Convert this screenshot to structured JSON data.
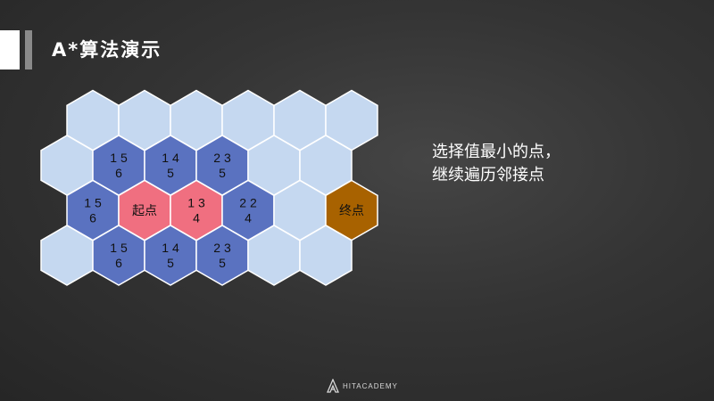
{
  "title": "A*算法演示",
  "instruction": {
    "line1": "选择值最小的点，",
    "line2": "继续遍历邻接点"
  },
  "colors": {
    "empty": "#c5d8f0",
    "neighbor": "#5a72c0",
    "open": "#f06f80",
    "start": "#f06f80",
    "goal": "#a86200",
    "outline": "#ffffff"
  },
  "grid": {
    "rows": [
      [
        {
          "state": "empty",
          "lines": []
        },
        {
          "state": "empty",
          "lines": []
        },
        {
          "state": "empty",
          "lines": []
        },
        {
          "state": "empty",
          "lines": []
        },
        {
          "state": "empty",
          "lines": []
        },
        {
          "state": "empty",
          "lines": []
        }
      ],
      [
        {
          "state": "empty",
          "lines": []
        },
        {
          "state": "neighbor",
          "lines": [
            "1 5",
            "6"
          ]
        },
        {
          "state": "neighbor",
          "lines": [
            "1 4",
            "5"
          ]
        },
        {
          "state": "neighbor",
          "lines": [
            "2 3",
            "5"
          ]
        },
        {
          "state": "empty",
          "lines": []
        },
        {
          "state": "empty",
          "lines": []
        }
      ],
      [
        {
          "state": "neighbor",
          "lines": [
            "1 5",
            "6"
          ]
        },
        {
          "state": "start",
          "lines": [
            "起点"
          ]
        },
        {
          "state": "open",
          "lines": [
            "1 3",
            "4"
          ]
        },
        {
          "state": "neighbor",
          "lines": [
            "2 2",
            "4"
          ]
        },
        {
          "state": "empty",
          "lines": []
        },
        {
          "state": "goal",
          "lines": [
            "终点"
          ]
        }
      ],
      [
        {
          "state": "empty",
          "lines": []
        },
        {
          "state": "neighbor",
          "lines": [
            "1 5",
            "6"
          ]
        },
        {
          "state": "neighbor",
          "lines": [
            "1 4",
            "5"
          ]
        },
        {
          "state": "neighbor",
          "lines": [
            "2 3",
            "5"
          ]
        },
        {
          "state": "empty",
          "lines": []
        },
        {
          "state": "empty",
          "lines": []
        }
      ]
    ]
  },
  "footer": {
    "logo_text": "HITACADEMY",
    "logo_icon": "hit-academy-logo-icon"
  }
}
